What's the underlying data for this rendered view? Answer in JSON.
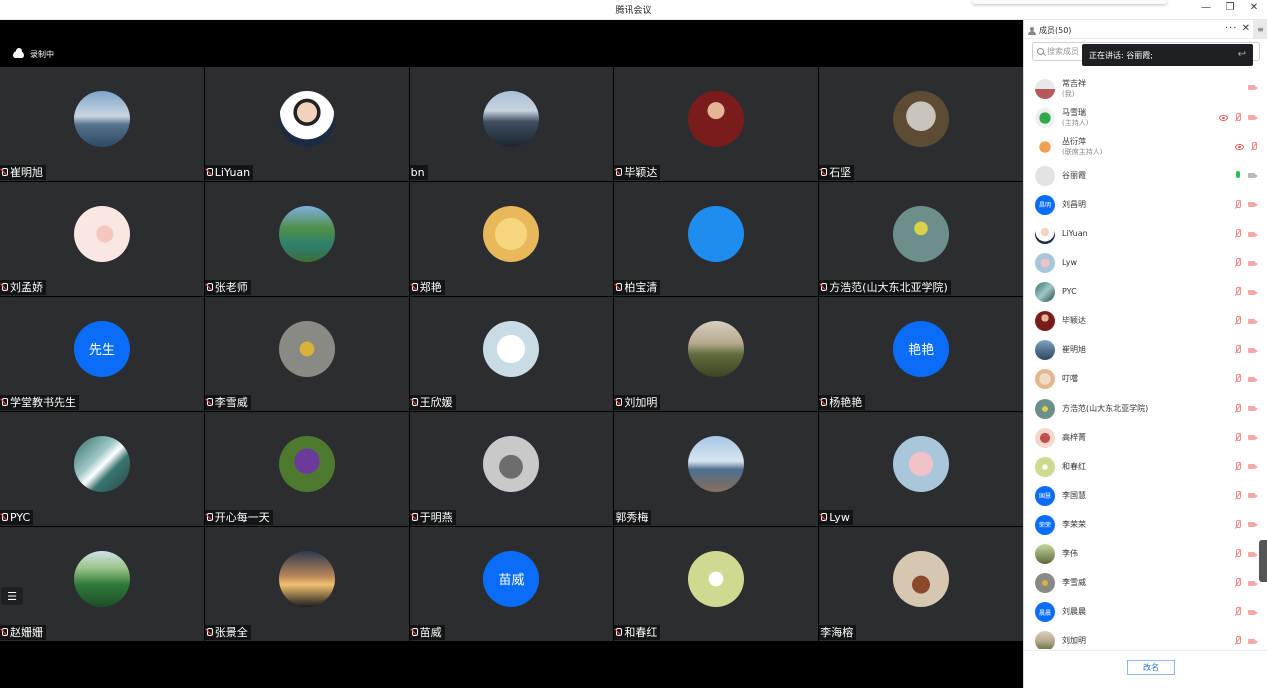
{
  "window": {
    "title": "腾讯会议",
    "min": "—",
    "restore": "❐",
    "close": "✕"
  },
  "stage": {
    "recording_label": "录制中",
    "menu_icon": "☰"
  },
  "tiles": [
    {
      "name": "崔明旭",
      "avatar": "photo",
      "bg": "linear-gradient(180deg,#7fa4c9 0%,#c9d6e1 45%,#56718c 60%,#2f4b63 100%)",
      "mic": true
    },
    {
      "name": "LiYuan",
      "avatar": "photo",
      "bg": "radial-gradient(circle at 50% 38%,#f0d2bd 0 22%,#222 23% 30%,#fff 31% 60%,#1b2b44 61%)",
      "mic": true
    },
    {
      "name": "bn",
      "avatar": "photo",
      "bg": "linear-gradient(180deg,#a9bfd7 0%,#c7d3de 35%,#3e4e5f 55%,#1c2630 100%)",
      "mic": false
    },
    {
      "name": "毕颖达",
      "avatar": "photo",
      "bg": "radial-gradient(circle at 50% 35%,#e4b596 0 18%,#7a1c1c 19% 100%)",
      "mic": true
    },
    {
      "name": "石坚",
      "avatar": "photo",
      "bg": "radial-gradient(circle at 50% 45%,#c9c4bc 0 35%,#5e4b33 36% 100%)",
      "mic": true
    },
    {
      "name": "刘孟娇",
      "avatar": "photo",
      "bg": "radial-gradient(circle at 55% 50%,#f6c6c0 0 20%,#fbe7e2 21% 100%)",
      "mic": true
    },
    {
      "name": "张老师",
      "avatar": "photo",
      "bg": "linear-gradient(180deg,#7fb0e0 0%,#4e8f48 40%,#2e7f6f 70%,#3d6e36 100%)",
      "mic": true
    },
    {
      "name": "郑艳",
      "avatar": "photo",
      "bg": "radial-gradient(circle at 50% 50%,#f5d67c 0 40%,#e8b85b 41% 100%)",
      "mic": true
    },
    {
      "name": "柏宝清",
      "avatar": "photo",
      "bg": "#1f8cf0",
      "mic": true
    },
    {
      "name": "方浩范(山大东北亚学院)",
      "avatar": "photo",
      "bg": "radial-gradient(circle at 50% 40%,#d9d24a 0 15%,#6d8f8c 16% 100%)",
      "mic": true
    },
    {
      "name": "学堂教书先生",
      "avatar": "text",
      "text": "先生",
      "mic": true
    },
    {
      "name": "李雪威",
      "avatar": "photo",
      "bg": "radial-gradient(circle at 50% 50%,#d9b23a 0 18%,#8a8a84 19% 100%)",
      "mic": true
    },
    {
      "name": "王欣媛",
      "avatar": "photo",
      "bg": "radial-gradient(circle at 50% 50%,#ffffff 0 35%,#c9dbe4 36% 100%)",
      "mic": true
    },
    {
      "name": "刘加明",
      "avatar": "photo",
      "bg": "linear-gradient(180deg,#d6cfc0 0%,#b7a98c 40%,#5f6b3b 60%,#3c4424 100%)",
      "mic": true
    },
    {
      "name": "杨艳艳",
      "avatar": "text",
      "text": "艳艳",
      "mic": true
    },
    {
      "name": "PYC",
      "avatar": "photo",
      "bg": "linear-gradient(135deg,#2f6b63 0%,#9fc9c8 40%,#ffffff 52%,#3a7572 65%,#25463f 100%)",
      "mic": true
    },
    {
      "name": "开心每一天",
      "avatar": "photo",
      "bg": "radial-gradient(circle at 50% 45%,#6b3b9c 0 30%,#4d7a2f 31% 100%)",
      "mic": true
    },
    {
      "name": "于明燕",
      "avatar": "photo",
      "bg": "radial-gradient(circle at 50% 55%,#6d6d6d 0 28%,#c9c9c9 29% 100%)",
      "mic": true
    },
    {
      "name": "郭秀梅",
      "avatar": "photo",
      "bg": "linear-gradient(180deg,#a8c6e6 0%,#d7e4ef 45%,#4c6f8f 60%,#8a6f5a 100%)",
      "mic": false
    },
    {
      "name": "Lyw",
      "avatar": "photo",
      "bg": "radial-gradient(circle at 50% 50%,#f2c2c8 0 30%,#a9c7da 31% 100%)",
      "mic": true
    },
    {
      "name": "赵姗姗",
      "avatar": "photo",
      "bg": "linear-gradient(180deg,#cfe0ee 0%,#9cc58a 30%,#2f7a3a 60%,#1e4f26 100%)",
      "mic": true
    },
    {
      "name": "张景全",
      "avatar": "photo",
      "bg": "linear-gradient(180deg,#2e3a4d 0%,#b9865a 45%,#f2c170 60%,#1c1c1c 100%)",
      "mic": true
    },
    {
      "name": "苗威",
      "avatar": "text",
      "text": "苗威",
      "mic": true
    },
    {
      "name": "和春红",
      "avatar": "photo",
      "bg": "radial-gradient(circle at 50% 50%,#ffffff 0 18%,#cfd98f 19% 100%)",
      "mic": true
    },
    {
      "name": "李海榕",
      "avatar": "photo",
      "bg": "radial-gradient(circle at 50% 60%,#8a4a2a 0 20%,#d6c7b0 21% 100%)",
      "mic": false
    }
  ],
  "panel": {
    "title": "成员(50)",
    "more": "···",
    "close": "✕",
    "side": "≡",
    "search_placeholder": "搜索成员",
    "speaking_label": "正在讲话: 谷丽霞;",
    "rename_button": "改名",
    "members": [
      {
        "name": "常吉祥",
        "sub": "(我)",
        "av": "photo",
        "bg": "linear-gradient(180deg,#e8e8e8 0 50%,#b85a5a 51%)",
        "icons": [
          "cam"
        ]
      },
      {
        "name": "马雪瑞",
        "sub": "(主持人)",
        "av": "photo",
        "bg": "radial-gradient(circle,#2fa84a 0 40%,#f0f0f0 41%)",
        "icons": [
          "eye",
          "mute",
          "cam"
        ]
      },
      {
        "name": "丛衍萍",
        "sub": "(联席主持人)",
        "av": "photo",
        "bg": "radial-gradient(circle,#f0a050 0 40%,#ffffff 41%)",
        "icons": [
          "eye",
          "mute"
        ]
      },
      {
        "name": "谷丽霞",
        "sub": "",
        "av": "photo",
        "bg": "#e3e3e3",
        "icons": [
          "mic",
          "camgrey"
        ]
      },
      {
        "name": "刘昌明",
        "sub": "",
        "av": "text",
        "text": "昌明",
        "icons": [
          "mute",
          "cam"
        ]
      },
      {
        "name": "LiYuan",
        "sub": "",
        "av": "photo",
        "bg": "radial-gradient(circle at 50% 40%,#f0d2bd 0 25%,#fff 26% 60%,#1b2b44 61%)",
        "icons": [
          "mute",
          "cam"
        ]
      },
      {
        "name": "Lyw",
        "sub": "",
        "av": "photo",
        "bg": "radial-gradient(circle,#f2c2c8 0 30%,#a9c7da 31%)",
        "icons": [
          "mute",
          "cam"
        ]
      },
      {
        "name": "PYC",
        "sub": "",
        "av": "photo",
        "bg": "linear-gradient(135deg,#2f6b63,#9fc9c8,#25463f)",
        "icons": [
          "mute",
          "cam"
        ]
      },
      {
        "name": "毕颖达",
        "sub": "",
        "av": "photo",
        "bg": "radial-gradient(circle at 50% 35%,#e4b596 0 22%,#7a1c1c 23%)",
        "icons": [
          "mute",
          "cam"
        ]
      },
      {
        "name": "崔明旭",
        "sub": "",
        "av": "photo",
        "bg": "linear-gradient(180deg,#7fa4c9,#56718c,#2f4b63)",
        "icons": [
          "mute",
          "cam"
        ]
      },
      {
        "name": "叮噹",
        "sub": "",
        "av": "photo",
        "bg": "radial-gradient(circle,#f3dcc6 0 40%,#e2b890 41%)",
        "icons": [
          "mute",
          "cam"
        ]
      },
      {
        "name": "方浩范(山大东北亚学院)",
        "sub": "",
        "av": "photo",
        "bg": "radial-gradient(circle,#d9d24a 0 20%,#6d8f8c 21%)",
        "icons": [
          "mute",
          "cam"
        ]
      },
      {
        "name": "高梓菁",
        "sub": "",
        "av": "photo",
        "bg": "radial-gradient(circle,#c0504d 0 35%,#f3d7cf 36%)",
        "icons": [
          "mute",
          "cam"
        ]
      },
      {
        "name": "和春红",
        "sub": "",
        "av": "photo",
        "bg": "radial-gradient(circle,#ffffff 0 18%,#cfd98f 19%)",
        "icons": [
          "mute",
          "cam"
        ]
      },
      {
        "name": "李国慧",
        "sub": "",
        "av": "text",
        "text": "国慧",
        "icons": [
          "mute",
          "cam"
        ]
      },
      {
        "name": "李荣荣",
        "sub": "",
        "av": "text",
        "text": "荣荣",
        "icons": [
          "mute",
          "cam"
        ]
      },
      {
        "name": "李伟",
        "sub": "",
        "av": "photo",
        "bg": "linear-gradient(180deg,#c9d7a0,#5b6a3a)",
        "icons": [
          "mute",
          "cam"
        ]
      },
      {
        "name": "李雪威",
        "sub": "",
        "av": "photo",
        "bg": "radial-gradient(circle,#d9b23a 0 20%,#8a8a84 21%)",
        "icons": [
          "mute",
          "cam"
        ]
      },
      {
        "name": "刘晨晨",
        "sub": "",
        "av": "text",
        "text": "晨晨",
        "icons": [
          "mute",
          "cam"
        ]
      },
      {
        "name": "刘加明",
        "sub": "",
        "av": "photo",
        "bg": "linear-gradient(180deg,#d6cfc0,#b7a98c,#5f6b3b)",
        "icons": [
          "mute",
          "cam"
        ]
      }
    ]
  }
}
